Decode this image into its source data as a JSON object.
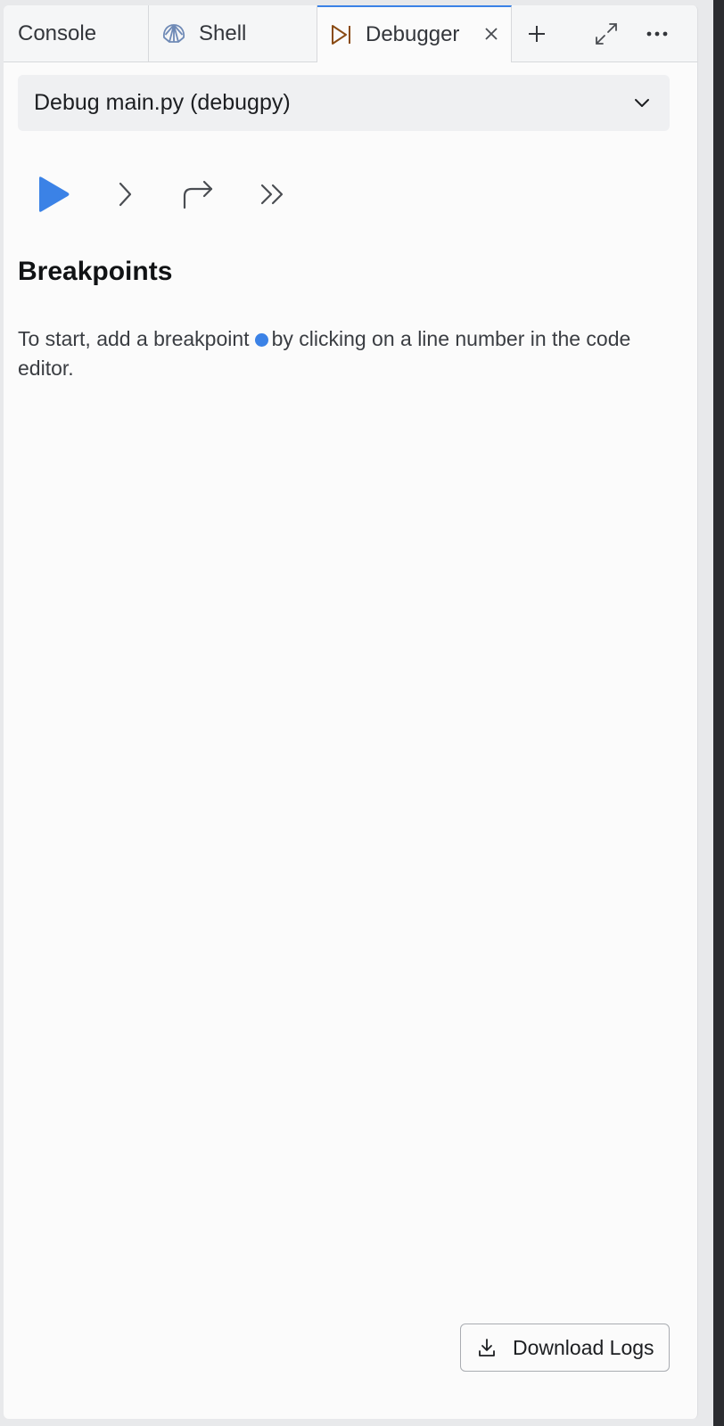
{
  "tabs": [
    {
      "label": "Console",
      "icon": "none"
    },
    {
      "label": "Shell",
      "icon": "shell-icon"
    },
    {
      "label": "Debugger",
      "icon": "debugger-icon",
      "active": true
    }
  ],
  "toolbar_icons": [
    "plus-icon",
    "expand-icon",
    "more-icon"
  ],
  "config_select": {
    "value": "Debug main.py (debugpy)"
  },
  "controls": [
    "play-icon",
    "step-into-icon",
    "step-over-icon",
    "continue-icon"
  ],
  "breakpoints": {
    "heading": "Breakpoints",
    "hint_before": "To start, add a breakpoint",
    "hint_after": "by clicking on a line number in the code editor."
  },
  "footer": {
    "download_label": "Download Logs"
  },
  "colors": {
    "accent": "#3b82e6",
    "debugger_icon": "#8a4b14",
    "shell_icon": "#6f8ab6"
  }
}
